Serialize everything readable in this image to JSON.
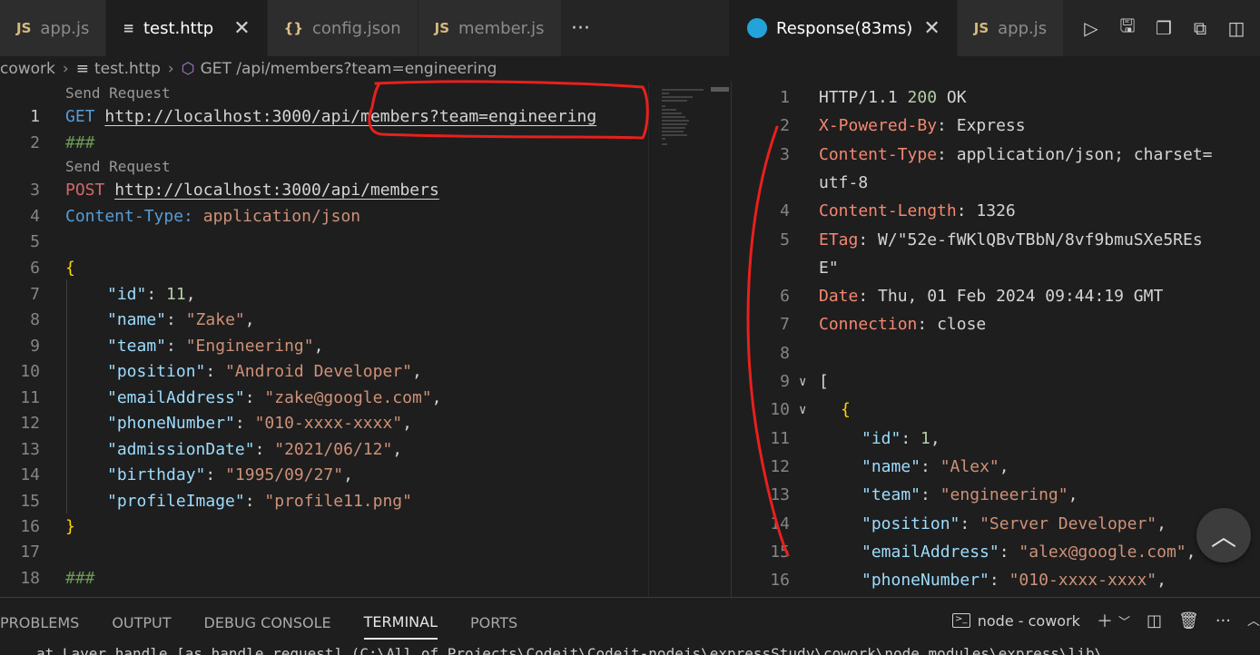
{
  "left_tabs": [
    {
      "icon": "JS",
      "label": "app.js",
      "active": false
    },
    {
      "icon": "≡",
      "label": "test.http",
      "active": true,
      "close": "✕"
    },
    {
      "icon": "{}",
      "label": "config.json",
      "active": false
    },
    {
      "icon": "JS",
      "label": "member.js",
      "active": false
    }
  ],
  "left_overflow": "···",
  "right_tabs": [
    {
      "label": "Response(83ms)",
      "close": "✕"
    },
    {
      "icon": "JS",
      "label": "app.js"
    }
  ],
  "breadcrumb": {
    "root": "cowork",
    "file": "test.http",
    "request": "GET /api/members?team=engineering"
  },
  "editor": {
    "codelens": "Send Request",
    "get_method": "GET",
    "get_url": "http://localhost:3000/api/members?team=engineering",
    "separator": "###",
    "post_method": "POST",
    "post_url": "http://localhost:3000/api/members",
    "header_name": "Content-Type:",
    "header_value": "application/json",
    "open_brace": "{",
    "close_brace": "}",
    "body": [
      {
        "key": "\"id\"",
        "value": "11",
        "type": "num"
      },
      {
        "key": "\"name\"",
        "value": "\"Zake\"",
        "type": "str"
      },
      {
        "key": "\"team\"",
        "value": "\"Engineering\"",
        "type": "str"
      },
      {
        "key": "\"position\"",
        "value": "\"Android Developer\"",
        "type": "str"
      },
      {
        "key": "\"emailAddress\"",
        "value": "\"zake@google.com\"",
        "type": "str"
      },
      {
        "key": "\"phoneNumber\"",
        "value": "\"010-xxxx-xxxx\"",
        "type": "str"
      },
      {
        "key": "\"admissionDate\"",
        "value": "\"2021/06/12\"",
        "type": "str"
      },
      {
        "key": "\"birthday\"",
        "value": "\"1995/09/27\"",
        "type": "str"
      },
      {
        "key": "\"profileImage\"",
        "value": "\"profile11.png\"",
        "type": "str",
        "last": true
      }
    ],
    "line_numbers": [
      "1",
      "2",
      "3",
      "4",
      "5",
      "6",
      "7",
      "8",
      "9",
      "10",
      "11",
      "12",
      "13",
      "14",
      "15",
      "16",
      "17",
      "18"
    ]
  },
  "response": {
    "status_proto": "HTTP/1.1",
    "status_code": "200",
    "status_text": "OK",
    "headers": [
      {
        "name": "X-Powered-By",
        "value": "Express"
      },
      {
        "name": "Content-Type",
        "value": "application/json; charset=",
        "wrap": "utf-8"
      },
      {
        "name": "Content-Length",
        "value": "1326"
      },
      {
        "name": "ETag",
        "value": "W/\"52e-fWKlQBvTBbN/8vf9bmuSXe5REs",
        "wrap": "E\""
      },
      {
        "name": "Date",
        "value": "Thu, 01 Feb 2024 09:44:19 GMT"
      },
      {
        "name": "Connection",
        "value": "close"
      }
    ],
    "open_bracket": "[",
    "open_brace": "{",
    "body": [
      {
        "key": "\"id\"",
        "value": "1",
        "type": "num"
      },
      {
        "key": "\"name\"",
        "value": "\"Alex\"",
        "type": "str"
      },
      {
        "key": "\"team\"",
        "value": "\"engineering\"",
        "type": "str"
      },
      {
        "key": "\"position\"",
        "value": "\"Server Developer\"",
        "type": "str"
      },
      {
        "key": "\"emailAddress\"",
        "value": "\"alex@google.com\"",
        "type": "str"
      },
      {
        "key": "\"phoneNumber\"",
        "value": "\"010-xxxx-xxxx\"",
        "type": "str"
      }
    ],
    "line_numbers": [
      "1",
      "2",
      "3",
      "4",
      "5",
      "6",
      "7",
      "8",
      "9",
      "10",
      "11",
      "12",
      "13",
      "14",
      "15",
      "16"
    ]
  },
  "panel": {
    "tabs": [
      "PROBLEMS",
      "OUTPUT",
      "DEBUG CONSOLE",
      "TERMINAL",
      "PORTS"
    ],
    "active_tab": "TERMINAL",
    "terminal_name": "node - cowork",
    "terminal_line": "at Layer.handle [as handle_request] (C:\\All of Projects\\Codeit\\Codeit-nodejs\\expressStudy\\cowork\\node_modules\\express\\lib\\"
  },
  "colors": {
    "annotation": "#e8201c",
    "accent": "#23a3d9"
  }
}
